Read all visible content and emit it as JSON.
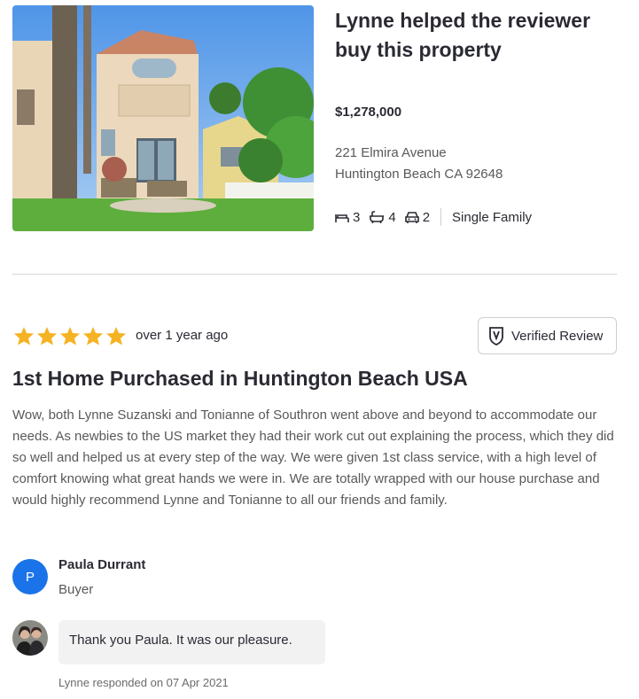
{
  "property": {
    "photo_icon": "house-photo",
    "title": "Lynne helped the reviewer buy this property",
    "price": "$1,278,000",
    "address_line1": "221 Elmira Avenue",
    "address_line2": "Huntington Beach CA 92648",
    "beds": "3",
    "baths": "4",
    "garage": "2",
    "type": "Single Family"
  },
  "review": {
    "rating": 5,
    "rating_max": 5,
    "age": "over 1 year ago",
    "verified_label": "Verified Review",
    "title": "1st Home Purchased in Huntington Beach USA",
    "body": "Wow, both Lynne Suzanski and Tonianne of Southron went above and beyond to accommodate our needs.  As newbies to the US market they had their work cut out explaining the process, which they did so well and helped us at every step of the way.  We were given 1st class service, with a high level of comfort knowing what great hands we were in.  We are totally wrapped with our house purchase and would highly recommend Lynne and Tonianne to all our friends and family."
  },
  "reviewer": {
    "initial": "P",
    "name": "Paula Durrant",
    "role": "Buyer"
  },
  "response": {
    "text": "Thank you Paula.  It was our pleasure.",
    "meta": "Lynne responded on 07 Apr 2021"
  },
  "colors": {
    "star": "#f5b324",
    "avatar": "#1a73e8",
    "bubble": "#f2f2f2"
  }
}
